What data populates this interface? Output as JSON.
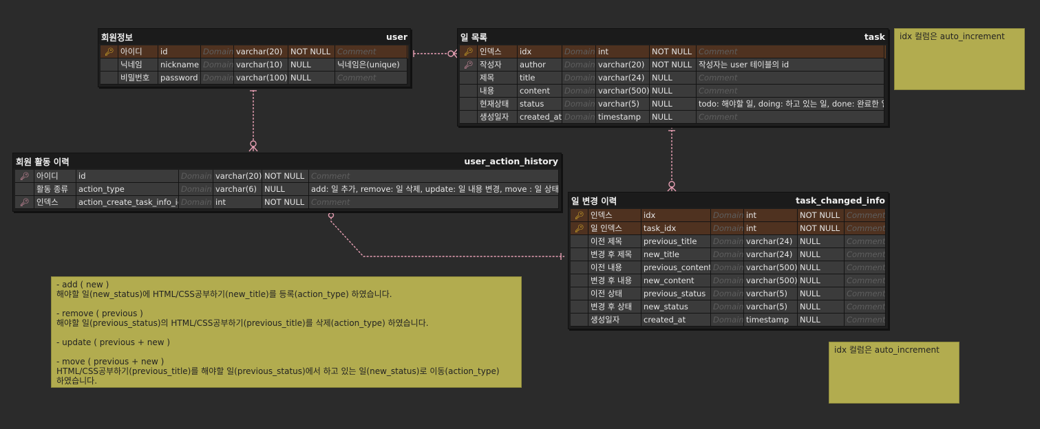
{
  "domain_colors": {
    "connector": "#e8a0b4",
    "pk_row": "#5a3a22",
    "note": "#b2ac4f"
  },
  "tables": {
    "user": {
      "logical": "회원정보",
      "physical": "user",
      "rows": [
        {
          "key": "pk",
          "logical": "아이디",
          "physical": "id",
          "domain": "Domain",
          "type": "varchar(20)",
          "null": "NOT NULL",
          "comment": "Comment",
          "comment_placeholder": true
        },
        {
          "key": "",
          "logical": "닉네임",
          "physical": "nickname",
          "domain": "Domain",
          "type": "varchar(10)",
          "null": "NULL",
          "comment": "닉네임은(unique)",
          "comment_placeholder": false
        },
        {
          "key": "",
          "logical": "비밀번호",
          "physical": "password",
          "domain": "Domain",
          "type": "varchar(100)",
          "null": "NULL",
          "comment": "Comment",
          "comment_placeholder": true
        }
      ]
    },
    "task": {
      "logical": "일 목록",
      "physical": "task",
      "rows": [
        {
          "key": "pk",
          "logical": "인덱스",
          "physical": "idx",
          "domain": "Domain",
          "type": "int",
          "null": "NOT NULL",
          "comment": "Comment",
          "comment_placeholder": true
        },
        {
          "key": "fk",
          "logical": "작성자",
          "physical": "author",
          "domain": "Domain",
          "type": "varchar(20)",
          "null": "NOT NULL",
          "comment": "작성자는 user 테이블의 id",
          "comment_placeholder": false
        },
        {
          "key": "",
          "logical": "제목",
          "physical": "title",
          "domain": "Domain",
          "type": "varchar(24)",
          "null": "NULL",
          "comment": "Comment",
          "comment_placeholder": true
        },
        {
          "key": "",
          "logical": "내용",
          "physical": "content",
          "domain": "Domain",
          "type": "varchar(500)",
          "null": "NULL",
          "comment": "Comment",
          "comment_placeholder": true
        },
        {
          "key": "",
          "logical": "현재상태",
          "physical": "status",
          "domain": "Domain",
          "type": "varchar(5)",
          "null": "NULL",
          "comment": "todo: 해야할 일, doing: 하고 있는 일, done: 완료한 일",
          "comment_placeholder": false
        },
        {
          "key": "",
          "logical": "생성일자",
          "physical": "created_at",
          "domain": "Domain",
          "type": "timestamp",
          "null": "NULL",
          "comment": "Comment",
          "comment_placeholder": true
        }
      ]
    },
    "user_action_history": {
      "logical": "회원 활동 이력",
      "physical": "user_action_history",
      "rows": [
        {
          "key": "fk",
          "logical": "아이디",
          "physical": "id",
          "domain": "Domain",
          "type": "varchar(20)",
          "null": "NOT NULL",
          "comment": "Comment",
          "comment_placeholder": true
        },
        {
          "key": "",
          "logical": "활동 종류",
          "physical": "action_type",
          "domain": "Domain",
          "type": "varchar(6)",
          "null": "NULL",
          "comment": "add: 일 추가, remove: 일 삭제, update: 일 내용 변경, move : 일 상태 변경",
          "comment_placeholder": false
        },
        {
          "key": "fk",
          "logical": "인덱스",
          "physical": "action_create_task_info_idx",
          "domain": "Domain",
          "type": "int",
          "null": "NOT NULL",
          "comment": "Comment",
          "comment_placeholder": true
        }
      ]
    },
    "task_changed_info": {
      "logical": "일 변경 이력",
      "physical": "task_changed_info",
      "rows": [
        {
          "key": "pk",
          "logical": "인덱스",
          "physical": "idx",
          "domain": "Domain",
          "type": "int",
          "null": "NOT NULL",
          "comment": "Comment",
          "comment_placeholder": true
        },
        {
          "key": "pkfk",
          "logical": "일 인덱스",
          "physical": "task_idx",
          "domain": "Domain",
          "type": "int",
          "null": "NOT NULL",
          "comment": "Comment",
          "comment_placeholder": true
        },
        {
          "key": "",
          "logical": "이전 제목",
          "physical": "previous_title",
          "domain": "Domain",
          "type": "varchar(24)",
          "null": "NULL",
          "comment": "Comment",
          "comment_placeholder": true
        },
        {
          "key": "",
          "logical": "변경 후 제목",
          "physical": "new_title",
          "domain": "Domain",
          "type": "varchar(24)",
          "null": "NULL",
          "comment": "Comment",
          "comment_placeholder": true
        },
        {
          "key": "",
          "logical": "이전 내용",
          "physical": "previous_content",
          "domain": "Domain",
          "type": "varchar(500)",
          "null": "NULL",
          "comment": "Comment",
          "comment_placeholder": true
        },
        {
          "key": "",
          "logical": "변경 후 내용",
          "physical": "new_content",
          "domain": "Domain",
          "type": "varchar(500)",
          "null": "NULL",
          "comment": "Comment",
          "comment_placeholder": true
        },
        {
          "key": "",
          "logical": "이전 상태",
          "physical": "previous_status",
          "domain": "Domain",
          "type": "varchar(5)",
          "null": "NULL",
          "comment": "Comment",
          "comment_placeholder": true
        },
        {
          "key": "",
          "logical": "변경 후 상태",
          "physical": "new_status",
          "domain": "Domain",
          "type": "varchar(5)",
          "null": "NULL",
          "comment": "Comment",
          "comment_placeholder": true
        },
        {
          "key": "",
          "logical": "생성일자",
          "physical": "created_at",
          "domain": "Domain",
          "type": "timestamp",
          "null": "NULL",
          "comment": "Comment",
          "comment_placeholder": true
        }
      ]
    }
  },
  "notes": {
    "note_task": {
      "lines": [
        "idx 컬럼은 auto_increment"
      ]
    },
    "note_changed": {
      "lines": [
        "idx 컬럼은 auto_increment"
      ]
    },
    "note_actions": {
      "lines": [
        "- add ( new )",
        "해야할 일(new_status)에 HTML/CSS공부하기(new_title)를 등록(action_type) 하였습니다.",
        "",
        "- remove ( previous )",
        "해야할 일(previous_status)의 HTML/CSS공부하기(previous_title)를 삭제(action_type) 하였습니다.",
        "",
        "- update ( previous + new )",
        "",
        "- move ( previous + new )",
        "HTML/CSS공부하기(previous_title)를 해야할 일(previous_status)에서 하고 있는 일(new_status)로 이동(action_type)",
        "하였습니다."
      ]
    }
  }
}
